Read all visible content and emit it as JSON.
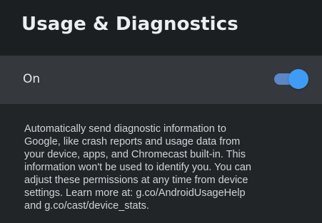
{
  "header": {
    "title": "Usage & Diagnostics"
  },
  "setting": {
    "label": "On",
    "enabled": true
  },
  "description": {
    "lines": [
      "Automatically send diagnostic information to",
      "Google, like crash reports and usage data from",
      "your device, apps, and Chromecast built-in. This",
      "information won't be used to identify you. You can",
      "adjust these permissions at any time from device",
      "settings. Learn more at: g.co/AndroidUsageHelp",
      "and g.co/cast/device_stats."
    ]
  },
  "colors": {
    "background": "#222528",
    "header_background": "#1c1f22",
    "row_background": "#35383c",
    "accent": "#3f9cf6"
  }
}
